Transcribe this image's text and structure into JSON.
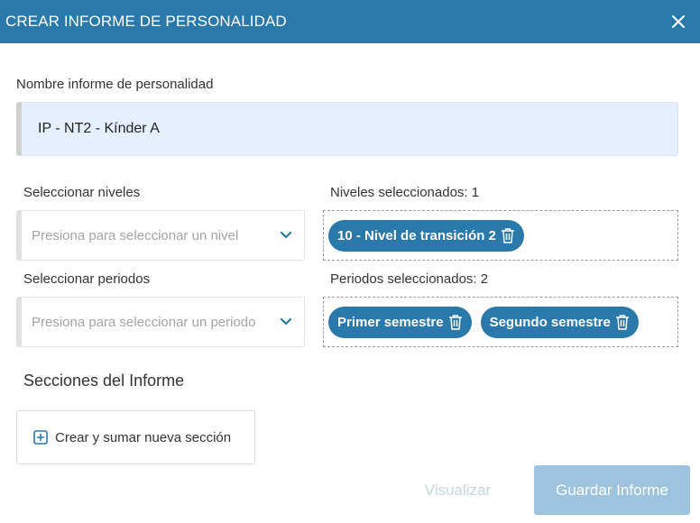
{
  "dialog": {
    "title": "CREAR INFORME DE PERSONALIDAD",
    "close_icon": "close-icon",
    "header_color": "#2979ab"
  },
  "name_field": {
    "label": "Nombre informe de personalidad",
    "value": "IP - NT2 - Kínder A"
  },
  "levels": {
    "select_label": "Seleccionar niveles",
    "select_placeholder": "Presiona para seleccionar un nivel",
    "selected_label": "Niveles seleccionados: 1",
    "chips": [
      "10 - Nivel de transición 2"
    ]
  },
  "periods": {
    "select_label": "Seleccionar periodos",
    "select_placeholder": "Presiona para seleccionar un periodo",
    "selected_label": "Periodos seleccionados: 2",
    "chips": [
      "Primer semestre",
      "Segundo semestre"
    ]
  },
  "sections": {
    "title": "Secciones del Informe",
    "add_button": "Crear y sumar nueva sección",
    "add_icon": "plus-square-icon"
  },
  "footer": {
    "visualize_label": "Visualizar",
    "save_label": "Guardar Informe"
  },
  "colors": {
    "accent": "#2979ab",
    "save_disabled": "#9ec3de",
    "name_field_bg": "#e5efff"
  }
}
